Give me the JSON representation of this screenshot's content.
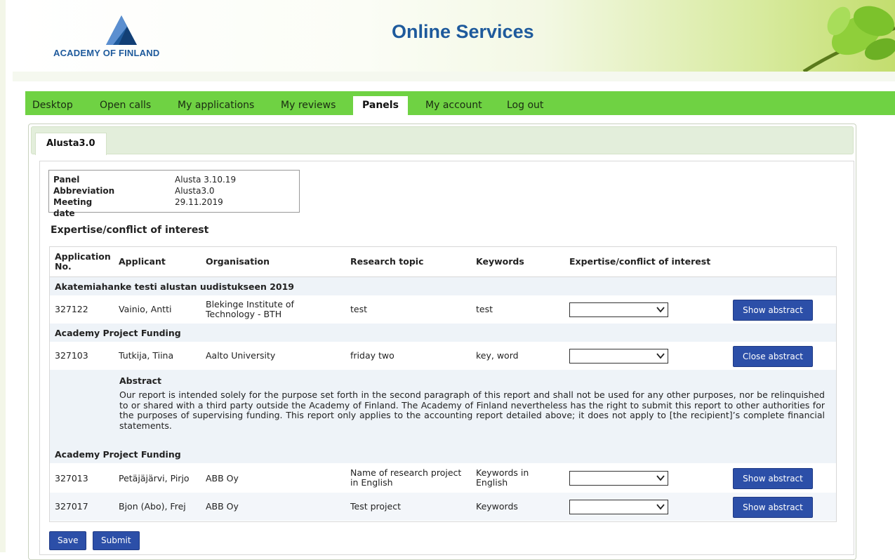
{
  "brand": {
    "logo_text": "ACADEMY OF FINLAND",
    "title": "Online Services"
  },
  "nav": {
    "items": [
      "Desktop",
      "Open calls",
      "My applications",
      "My reviews",
      "Panels",
      "My account",
      "Log out"
    ],
    "active": "Panels"
  },
  "tab": {
    "label": "Alusta3.0"
  },
  "info": {
    "panel_label": "Panel",
    "panel_value": "Alusta 3.10.19",
    "abbr_label": "Abbreviation",
    "abbr_value": "Alusta3.0",
    "date_label": "Meeting date",
    "date_value": "29.11.2019"
  },
  "section_title": "Expertise/conflict of interest",
  "table": {
    "headers": [
      "Application No.",
      "Applicant",
      "Organisation",
      "Research topic",
      "Keywords",
      "Expertise/conflict of interest"
    ],
    "groups": [
      {
        "title": "Akatemiahanke testi alustan uudistukseen 2019",
        "rows": [
          {
            "no": "327122",
            "applicant": "Vainio, Antti",
            "org": "Blekinge Institute of Technology - BTH",
            "topic": "test",
            "keywords": "test",
            "select": "",
            "button": "Show abstract"
          }
        ]
      },
      {
        "title": "Academy Project Funding",
        "rows": [
          {
            "no": "327103",
            "applicant": "Tutkija, Tiina",
            "org": "Aalto University",
            "topic": "friday two",
            "keywords": "key, word",
            "select": "",
            "button": "Close abstract"
          }
        ],
        "abstract": {
          "title": "Abstract",
          "text": "Our report is intended solely for the purpose set forth in the second paragraph of this report and shall not be used for any other purposes, nor be relinquished to or shared with a third party outside the Academy of Finland. The Academy of Finland nevertheless has the right to submit this report to other authorities for the purposes of supervising funding. This report only applies to the accounting report detailed above; it does not apply to [the recipient]’s complete financial statements."
        }
      },
      {
        "title": "Academy Project Funding",
        "rows": [
          {
            "no": "327013",
            "applicant": "Petäjäjärvi, Pirjo",
            "org": "ABB Oy",
            "topic": "Name of research project in English",
            "keywords": "Keywords in English",
            "select": "",
            "button": "Show abstract"
          },
          {
            "no": "327017",
            "applicant": "Bjon (Abo), Frej",
            "org": "ABB Oy",
            "topic": "Test project",
            "keywords": "Keywords",
            "select": "",
            "button": "Show abstract"
          }
        ]
      }
    ]
  },
  "actions": {
    "save": "Save",
    "submit": "Submit"
  },
  "colors": {
    "nav_green": "#6fd243",
    "brand_blue": "#1e5a9c",
    "button_blue": "#2c4fa8"
  }
}
